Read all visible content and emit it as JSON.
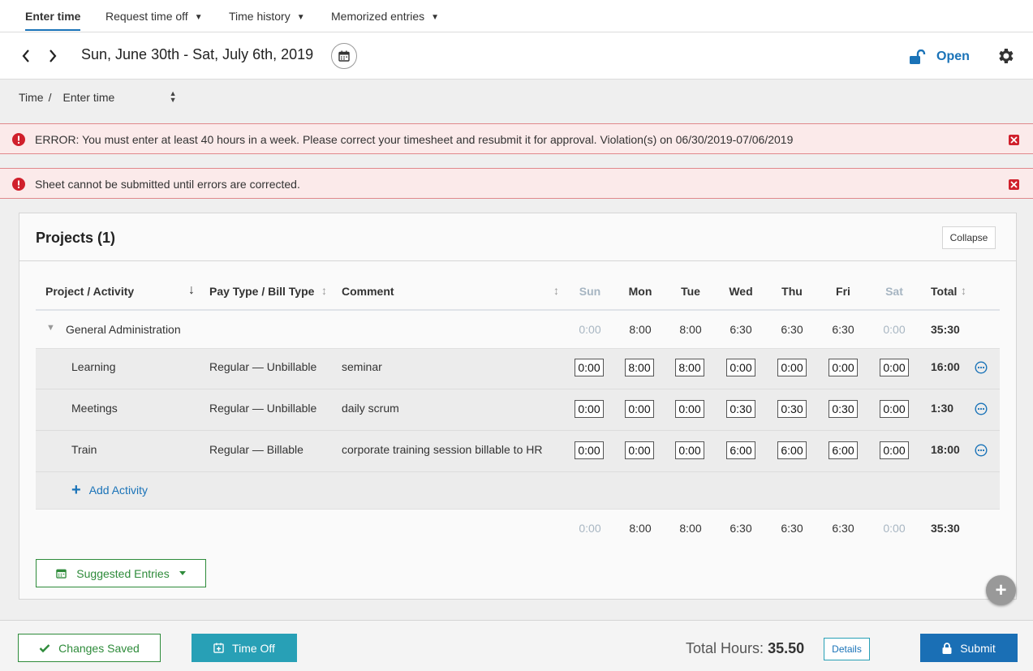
{
  "nav": {
    "tabs": [
      {
        "label": "Enter time",
        "active": true
      },
      {
        "label": "Request time off",
        "dropdown": true
      },
      {
        "label": "Time history",
        "dropdown": true
      },
      {
        "label": "Memorized entries",
        "dropdown": true
      }
    ]
  },
  "header": {
    "date_range": "Sun, June 30th - Sat, July 6th, 2019",
    "status": "Open"
  },
  "breadcrumb": {
    "root": "Time",
    "separator": "/",
    "current": "Enter time"
  },
  "alerts": [
    {
      "message": "ERROR: You must enter at least 40 hours in a week. Please correct your timesheet and resubmit it for approval. Violation(s) on 06/30/2019-07/06/2019"
    },
    {
      "message": "Sheet cannot be submitted until errors are corrected."
    }
  ],
  "projects": {
    "title": "Projects (1)",
    "collapse_label": "Collapse",
    "columns": {
      "project": "Project / Activity",
      "paytype": "Pay Type / Bill Type",
      "comment": "Comment",
      "days": [
        "Sun",
        "Mon",
        "Tue",
        "Wed",
        "Thu",
        "Fri",
        "Sat"
      ],
      "total": "Total"
    },
    "group": {
      "name": "General Administration",
      "days": [
        "0:00",
        "8:00",
        "8:00",
        "6:30",
        "6:30",
        "6:30",
        "0:00"
      ],
      "total": "35:30"
    },
    "activities": [
      {
        "name": "Learning",
        "paytype": "Regular — Unbillable",
        "comment": "seminar",
        "days": [
          "0:00",
          "8:00",
          "8:00",
          "0:00",
          "0:00",
          "0:00",
          "0:00"
        ],
        "total": "16:00"
      },
      {
        "name": "Meetings",
        "paytype": "Regular — Unbillable",
        "comment": "daily scrum",
        "days": [
          "0:00",
          "0:00",
          "0:00",
          "0:30",
          "0:30",
          "0:30",
          "0:00"
        ],
        "total": "1:30"
      },
      {
        "name": "Train",
        "paytype": "Regular — Billable",
        "comment": "corporate training session billable to HR",
        "days": [
          "0:00",
          "0:00",
          "0:00",
          "6:00",
          "6:00",
          "6:00",
          "0:00"
        ],
        "total": "18:00"
      }
    ],
    "add_activity_label": "Add Activity",
    "totals": {
      "days": [
        "0:00",
        "8:00",
        "8:00",
        "6:30",
        "6:30",
        "6:30",
        "0:00"
      ],
      "total": "35:30"
    },
    "suggested_label": "Suggested Entries"
  },
  "footer": {
    "saved_label": "Changes Saved",
    "timeoff_label": "Time Off",
    "total_hours_label": "Total Hours:",
    "total_hours_value": "35.50",
    "details_label": "Details",
    "submit_label": "Submit"
  },
  "colors": {
    "accent": "#1a73b8",
    "error_bg": "#fbeaea",
    "error_icon": "#d0202c",
    "success": "#2e8b3a",
    "teal": "#28a0b6"
  }
}
